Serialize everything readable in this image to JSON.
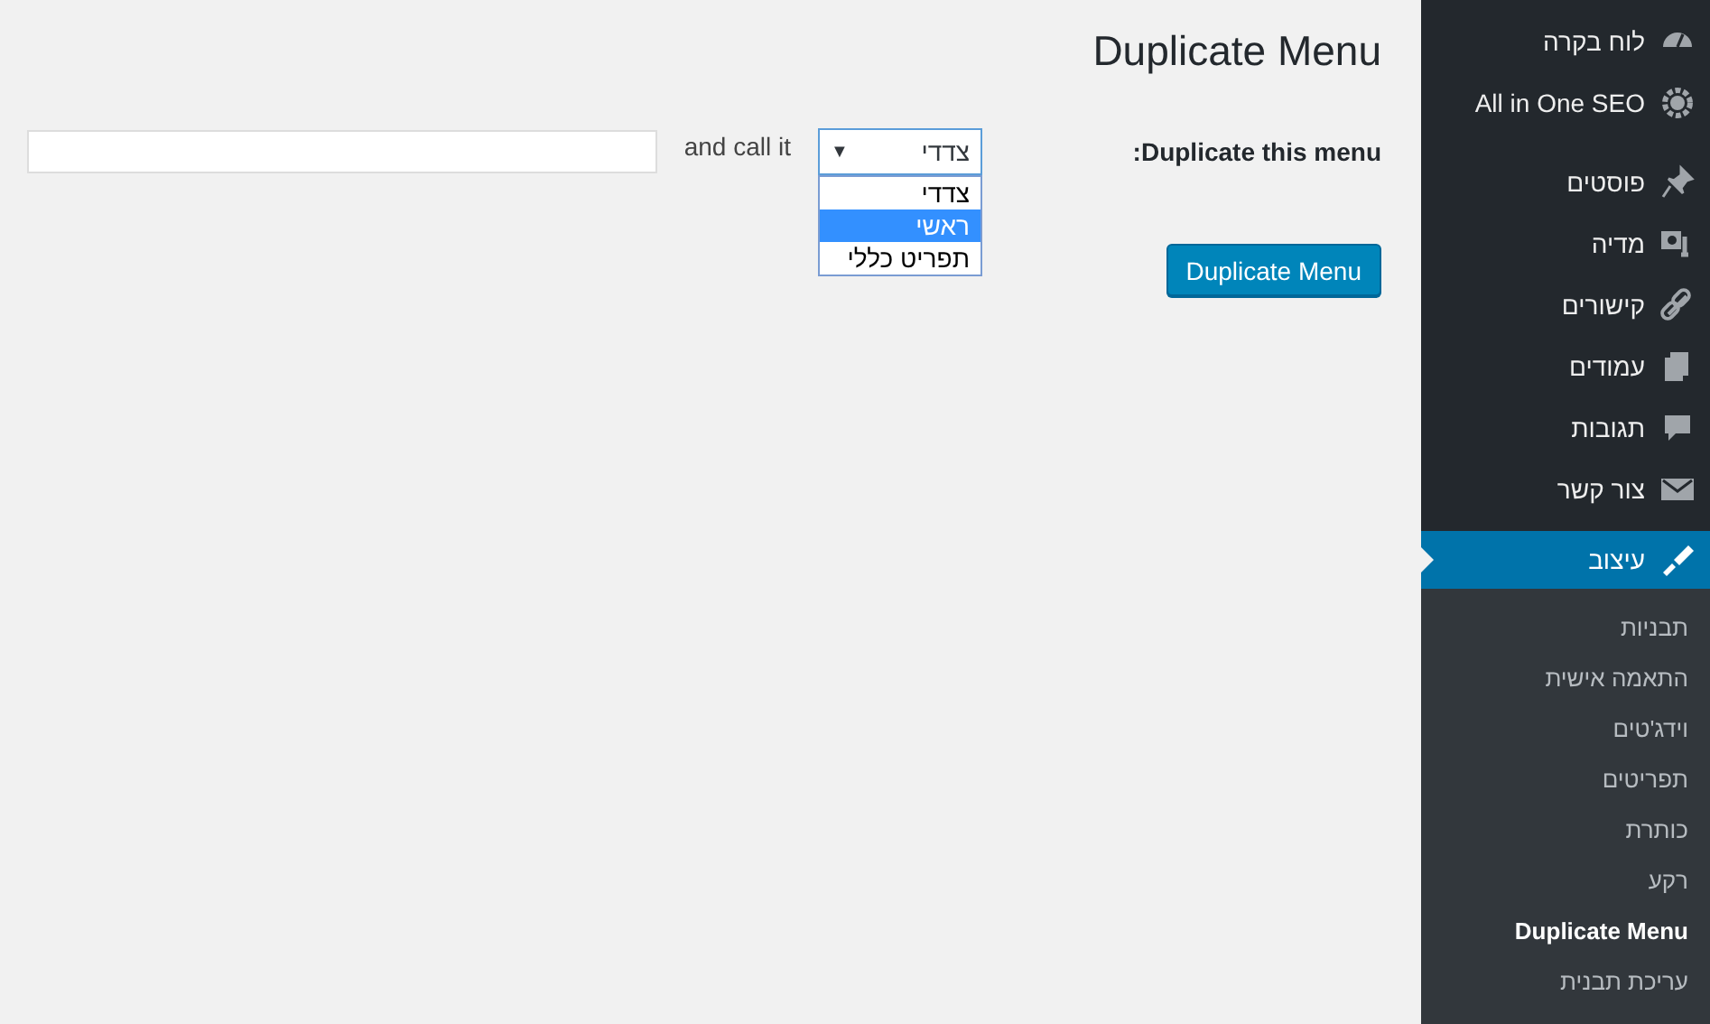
{
  "sidebar": {
    "items": [
      {
        "label": "לוח בקרה",
        "selected": false
      },
      {
        "label": "All in One SEO",
        "selected": false
      },
      {
        "label": "פוסטים",
        "selected": false
      },
      {
        "label": "מדיה",
        "selected": false
      },
      {
        "label": "קישורים",
        "selected": false
      },
      {
        "label": "עמודים",
        "selected": false
      },
      {
        "label": "תגובות",
        "selected": false
      },
      {
        "label": "צור קשר",
        "selected": false
      },
      {
        "label": "עיצוב",
        "selected": true
      }
    ],
    "submenu": [
      {
        "label": "תבניות",
        "selected": false
      },
      {
        "label": "התאמה אישית",
        "selected": false
      },
      {
        "label": "וידג'טים",
        "selected": false
      },
      {
        "label": "תפריטים",
        "selected": false
      },
      {
        "label": "כותרת",
        "selected": false
      },
      {
        "label": "רקע",
        "selected": false
      },
      {
        "label": "Duplicate Menu",
        "selected": true
      },
      {
        "label": "עריכת תבנית",
        "selected": false
      }
    ]
  },
  "page": {
    "title": "Duplicate Menu",
    "form": {
      "label": "Duplicate this menu:",
      "select": {
        "value": "צדדי",
        "arrow": "▼",
        "expanded": true,
        "options": [
          {
            "label": "צדדי",
            "highlighted": false
          },
          {
            "label": "ראשי",
            "highlighted": true
          },
          {
            "label": "תפריט כללי",
            "highlighted": false
          }
        ]
      },
      "connector": "and call it"
    },
    "button": "Duplicate Menu"
  }
}
